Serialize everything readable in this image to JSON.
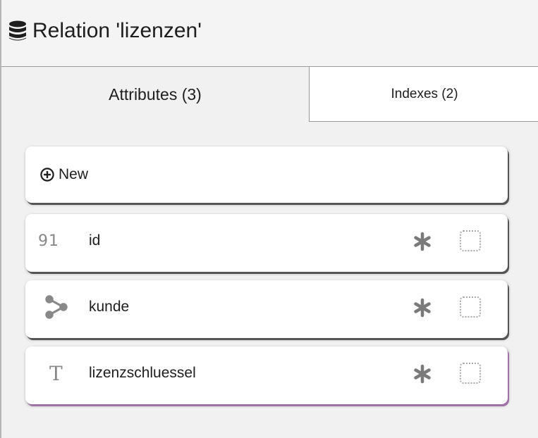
{
  "header": {
    "icon": "database-icon",
    "title": "Relation 'lizenzen'"
  },
  "tabs": [
    {
      "label": "Attributes (3)",
      "active": true
    },
    {
      "label": "Indexes (2)",
      "active": false
    }
  ],
  "new_button": {
    "icon": "plus-circle-icon",
    "label": "New"
  },
  "attributes": [
    {
      "type_icon": "numeric-type-icon",
      "type_glyph": "91",
      "name": "id",
      "required_icon": "asterisk-icon",
      "primary_key_checked": false
    },
    {
      "type_icon": "relation-type-icon",
      "type_glyph": "",
      "name": "kunde",
      "required_icon": "asterisk-icon",
      "primary_key_checked": false
    },
    {
      "type_icon": "text-type-icon",
      "type_glyph": "T",
      "name": "lizenzschluessel",
      "required_icon": "asterisk-icon",
      "primary_key_checked": false
    }
  ],
  "colors": {
    "background": "#f1f1f1",
    "card": "#ffffff",
    "icon_gray": "#888888",
    "last_card_accent": "#a071a6"
  }
}
